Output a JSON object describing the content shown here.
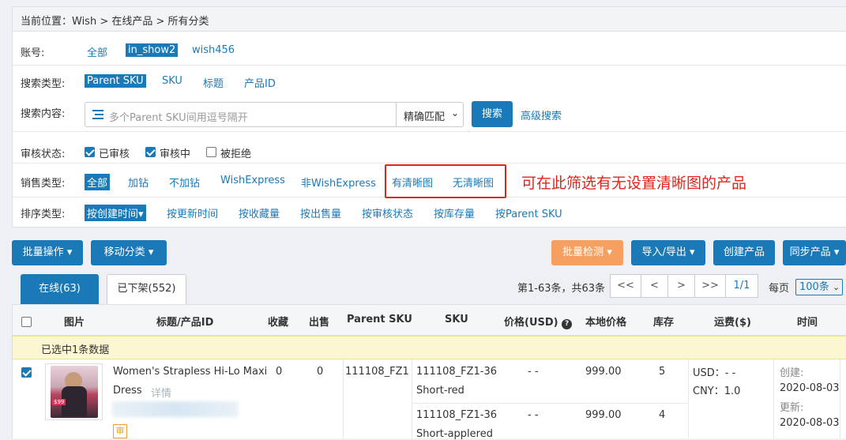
{
  "breadcrumb": "当前位置：Wish > 在线产品 > 所有分类",
  "account": {
    "label": "账号:",
    "options": [
      "全部",
      "in_show2",
      "wish456"
    ],
    "selected": "in_show2"
  },
  "search_type": {
    "label": "搜索类型:",
    "options": [
      "Parent SKU",
      "SKU",
      "标题",
      "产品ID"
    ],
    "selected": "Parent SKU"
  },
  "search_content": {
    "label": "搜索内容:",
    "placeholder": "多个Parent SKU间用逗号隔开",
    "match_mode": "精确匹配",
    "search_button": "搜索",
    "advanced": "高级搜索"
  },
  "review_status": {
    "label": "审核状态:",
    "options": [
      {
        "label": "已审核",
        "checked": true
      },
      {
        "label": "审核中",
        "checked": true
      },
      {
        "label": "被拒绝",
        "checked": false
      }
    ]
  },
  "sale_type": {
    "label": "销售类型:",
    "options": [
      "全部",
      "加钻",
      "不加钻",
      "WishExpress",
      "非WishExpress",
      "有清晰图",
      "无清晰图"
    ],
    "selected": "全部"
  },
  "annotation": "可在此筛选有无设置清晰图的产品",
  "sort_type": {
    "label": "排序类型:",
    "options": [
      "按创建时间",
      "按更新时间",
      "按收藏量",
      "按出售量",
      "按审核状态",
      "按库存量",
      "按Parent SKU"
    ],
    "selected": "按创建时间"
  },
  "toolbar": {
    "bulk_ops": "批量操作",
    "move_category": "移动分类",
    "bulk_check": "批量检测",
    "import_export": "导入/导出",
    "create_product": "创建产品",
    "sync_product": "同步产品"
  },
  "tabs": {
    "online": "在线(63)",
    "offline": "已下架(552)"
  },
  "pagination": {
    "summary": "第1-63条，共63条",
    "first": "<<",
    "prev": "<",
    "next": ">",
    "last": ">>",
    "page": "1/1",
    "per_page_label": "每页",
    "per_page_value": "100条"
  },
  "table": {
    "headers": [
      "图片",
      "标题/产品ID",
      "收藏",
      "出售",
      "Parent SKU",
      "SKU",
      "价格(USD)",
      "本地价格",
      "库存",
      "运费($)",
      "时间"
    ],
    "selected_notice": "已选中1条数据",
    "rows": [
      {
        "title_line1": "Women's Strapless Hi-Lo Maxi",
        "title_line2": "Dress",
        "detail_link": "详情",
        "review_badge": "审",
        "favorites": "0",
        "sold": "0",
        "parent_sku": "111108_FZ1",
        "image_price_tag": "$99",
        "variants": [
          {
            "sku_line1": "111108_FZ1-36",
            "sku_line2": "Short-red",
            "price": "- -",
            "local_price": "999.00",
            "stock": "5"
          },
          {
            "sku_line1": "111108_FZ1-36",
            "sku_line2": "Short-applered",
            "price": "- -",
            "local_price": "999.00",
            "stock": "4"
          }
        ],
        "shipping_usd": "USD：- -",
        "shipping_cny": "CNY：1.0",
        "created_label": "创建:",
        "created_date": "2020-08-03",
        "updated_label": "更新:",
        "updated_date": "2020-08-03"
      }
    ]
  },
  "colors": {
    "primary": "#1a7ab8",
    "accent_orange": "#f5a060",
    "annotation_red": "#e0251b",
    "selected_bar": "#fdf7d1"
  }
}
